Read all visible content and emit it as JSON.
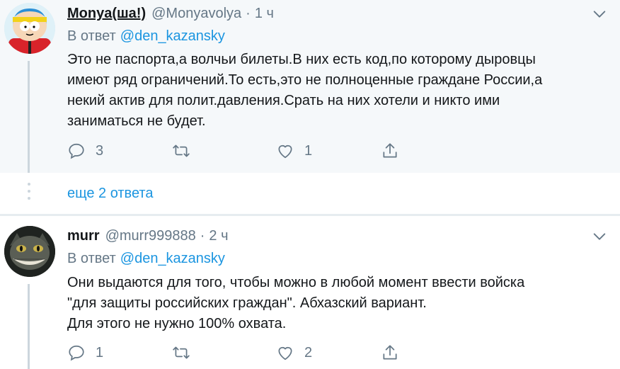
{
  "tweets": [
    {
      "name": "Monya(ша!)",
      "handle": "@Monyavolya",
      "dot": "·",
      "time": "1 ч",
      "reply_prefix": "В ответ",
      "reply_to": "@den_kazansky",
      "text_lines": [
        "Это не паспорта,а волчьи билеты.В них есть код,по которому дыровцы",
        "имеют ряд ограничений.То есть,это не полноценные граждане России,а",
        "некий актив для полит.давления.Срать на них хотели и никто ими",
        "заниматься не будет."
      ],
      "counts": {
        "replies": "3",
        "retweets": "",
        "likes": "1"
      },
      "icons": {
        "reply": "reply-icon",
        "retweet": "retweet-icon",
        "like": "heart-icon",
        "share": "share-icon",
        "menu": "chevron-down-icon"
      }
    },
    {
      "name": "murr",
      "handle": "@murr999888",
      "dot": "·",
      "time": "2 ч",
      "reply_prefix": "В ответ",
      "reply_to": "@den_kazansky",
      "text_lines": [
        "Они выдаются для того, чтобы можно в любой момент ввести войска",
        "\"для защиты российских граждан\". Абхазский вариант.",
        "Для этого не нужно 100% охвата."
      ],
      "counts": {
        "replies": "1",
        "retweets": "",
        "likes": "2"
      },
      "icons": {
        "reply": "reply-icon",
        "retweet": "retweet-icon",
        "like": "heart-icon",
        "share": "share-icon",
        "menu": "chevron-down-icon"
      }
    }
  ],
  "more_replies": {
    "label": "еще 2 ответа"
  },
  "colors": {
    "accent": "#1b95e0",
    "muted": "#657786",
    "highlight_bg": "#f5f8fa",
    "line": "#ccd6dd"
  }
}
